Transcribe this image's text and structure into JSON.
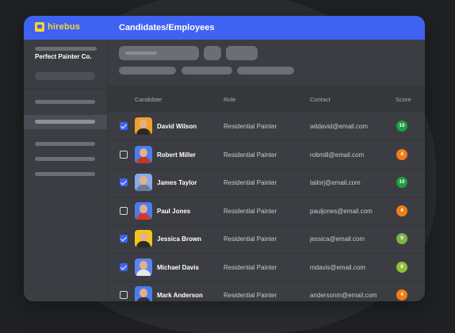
{
  "app": {
    "logo_text": "hirebus",
    "title": "Candidates/Employees",
    "accent": "#3f62f2"
  },
  "sidebar": {
    "company": "Perfect Painter Co."
  },
  "table": {
    "headers": {
      "candidate": "Candidate",
      "role": "Role",
      "contact": "Contact",
      "score": "Score"
    },
    "rows": [
      {
        "checked": true,
        "name": "David Wilson",
        "role": "Residential Painter",
        "contact": "wildavid@email.com",
        "score": "10",
        "score_color": "#1e9e3e",
        "avatar_bg": "#f0a12a",
        "shirt": "#2a2a2a"
      },
      {
        "checked": false,
        "name": "Robert Miller",
        "role": "Residential Painter",
        "contact": "robmill@email.com",
        "score": "4",
        "score_color": "#f07c1a",
        "avatar_bg": "#4a7df0",
        "shirt": "#c0392b"
      },
      {
        "checked": true,
        "name": "James Taylor",
        "role": "Residential Painter",
        "contact": "tailorj@email.com",
        "score": "10",
        "score_color": "#1e9e3e",
        "avatar_bg": "#8aa9e6",
        "shirt": "#6b7b93"
      },
      {
        "checked": false,
        "name": "Paul Jones",
        "role": "Residential Painter",
        "contact": "pauljones@email.com",
        "score": "4",
        "score_color": "#f07c1a",
        "avatar_bg": "#4a7df0",
        "shirt": "#d43a2a"
      },
      {
        "checked": true,
        "name": "Jessica Brown",
        "role": "Residential Painter",
        "contact": "jessica@email.com",
        "score": "9",
        "score_color": "#7ab648",
        "avatar_bg": "#f5c518",
        "shirt": "#2b2b2b"
      },
      {
        "checked": true,
        "name": "Michael Davis",
        "role": "Residential Painter",
        "contact": "mdavis@email.com",
        "score": "8",
        "score_color": "#8fbf3a",
        "avatar_bg": "#5b86f0",
        "shirt": "#e8e8e8"
      },
      {
        "checked": false,
        "name": "Mark Anderson",
        "role": "Residential Painter",
        "contact": "andersonm@email.com",
        "score": "4",
        "score_color": "#f07c1a",
        "avatar_bg": "#4a7df0",
        "shirt": "#333333"
      }
    ]
  }
}
